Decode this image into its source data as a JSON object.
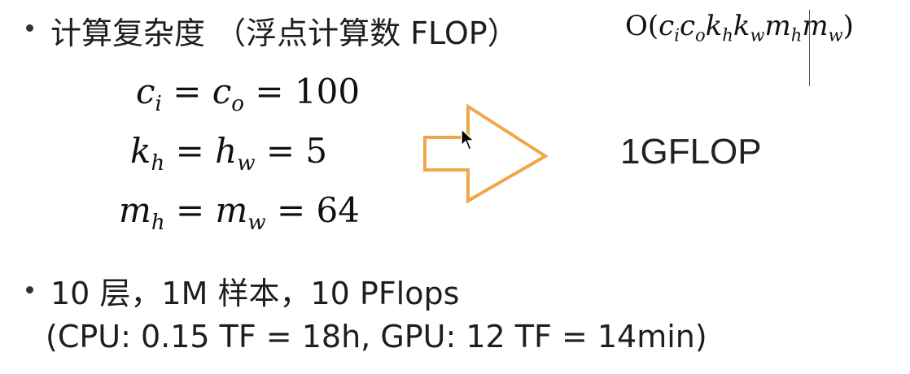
{
  "bullets": [
    {
      "text": "计算复杂度 （浮点计算数 FLOP）",
      "formula": {
        "prefix": "O(",
        "terms": [
          {
            "base": "c",
            "sub": "i"
          },
          {
            "base": "c",
            "sub": "o"
          },
          {
            "base": "k",
            "sub": "h"
          },
          {
            "base": "k",
            "sub": "w"
          },
          {
            "base": "m",
            "sub": "h"
          },
          {
            "base": "m",
            "sub": "w"
          }
        ],
        "suffix": ")"
      }
    },
    {
      "text": "10 层，1M 样本，10 PFlops",
      "detail": "(CPU: 0.15 TF = 18h, GPU: 12 TF = 14min)"
    }
  ],
  "equations": [
    {
      "lhs_base": "c",
      "lhs_sub": "i",
      "rhs_base": "c",
      "rhs_sub": "o",
      "value": "100"
    },
    {
      "lhs_base": "k",
      "lhs_sub": "h",
      "rhs_base": "h",
      "rhs_sub": "w",
      "value": "5"
    },
    {
      "lhs_base": "m",
      "lhs_sub": "h",
      "rhs_base": "m",
      "rhs_sub": "w",
      "value": "64"
    }
  ],
  "result": "1GFLOP",
  "colors": {
    "arrow_stroke": "#F0A74A",
    "text": "#1e1e1e"
  },
  "icons": {
    "arrow": "right-arrow-outline-icon",
    "cursor": "mouse-pointer-icon"
  }
}
